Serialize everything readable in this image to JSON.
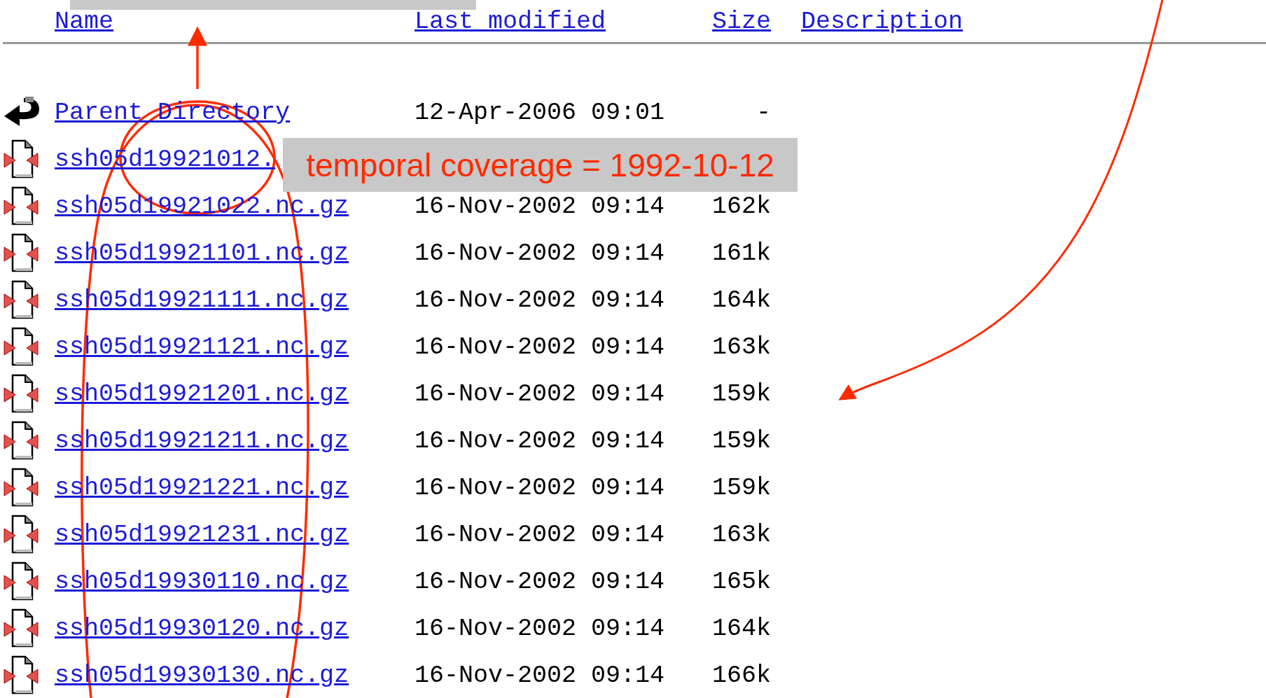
{
  "columns": [
    "Name",
    "Last modified",
    "Size",
    "Description"
  ],
  "rows": [
    {
      "kind": "parent",
      "name": "Parent Directory",
      "modified": "12-Apr-2006 09:01",
      "size": "-"
    },
    {
      "kind": "file",
      "name": "ssh05d19921012."
    },
    {
      "kind": "file",
      "name": "ssh05d19921022.nc.gz",
      "modified": "16-Nov-2002 09:14",
      "size": "162k"
    },
    {
      "kind": "file",
      "name": "ssh05d19921101.nc.gz",
      "modified": "16-Nov-2002 09:14",
      "size": "161k"
    },
    {
      "kind": "file",
      "name": "ssh05d19921111.nc.gz",
      "modified": "16-Nov-2002 09:14",
      "size": "164k"
    },
    {
      "kind": "file",
      "name": "ssh05d19921121.nc.gz",
      "modified": "16-Nov-2002 09:14",
      "size": "163k"
    },
    {
      "kind": "file",
      "name": "ssh05d19921201.nc.gz",
      "modified": "16-Nov-2002 09:14",
      "size": "159k"
    },
    {
      "kind": "file",
      "name": "ssh05d19921211.nc.gz",
      "modified": "16-Nov-2002 09:14",
      "size": "159k"
    },
    {
      "kind": "file",
      "name": "ssh05d19921221.nc.gz",
      "modified": "16-Nov-2002 09:14",
      "size": "159k"
    },
    {
      "kind": "file",
      "name": "ssh05d19921231.nc.gz",
      "modified": "16-Nov-2002 09:14",
      "size": "163k"
    },
    {
      "kind": "file",
      "name": "ssh05d19930110.nc.gz",
      "modified": "16-Nov-2002 09:14",
      "size": "165k"
    },
    {
      "kind": "file",
      "name": "ssh05d19930120.nc.gz",
      "modified": "16-Nov-2002 09:14",
      "size": "164k"
    },
    {
      "kind": "file",
      "name": "ssh05d19930130.nc.gz",
      "modified": "16-Nov-2002 09:14",
      "size": "166k"
    }
  ],
  "annotation": {
    "label": "temporal coverage = 1992-10-12"
  }
}
